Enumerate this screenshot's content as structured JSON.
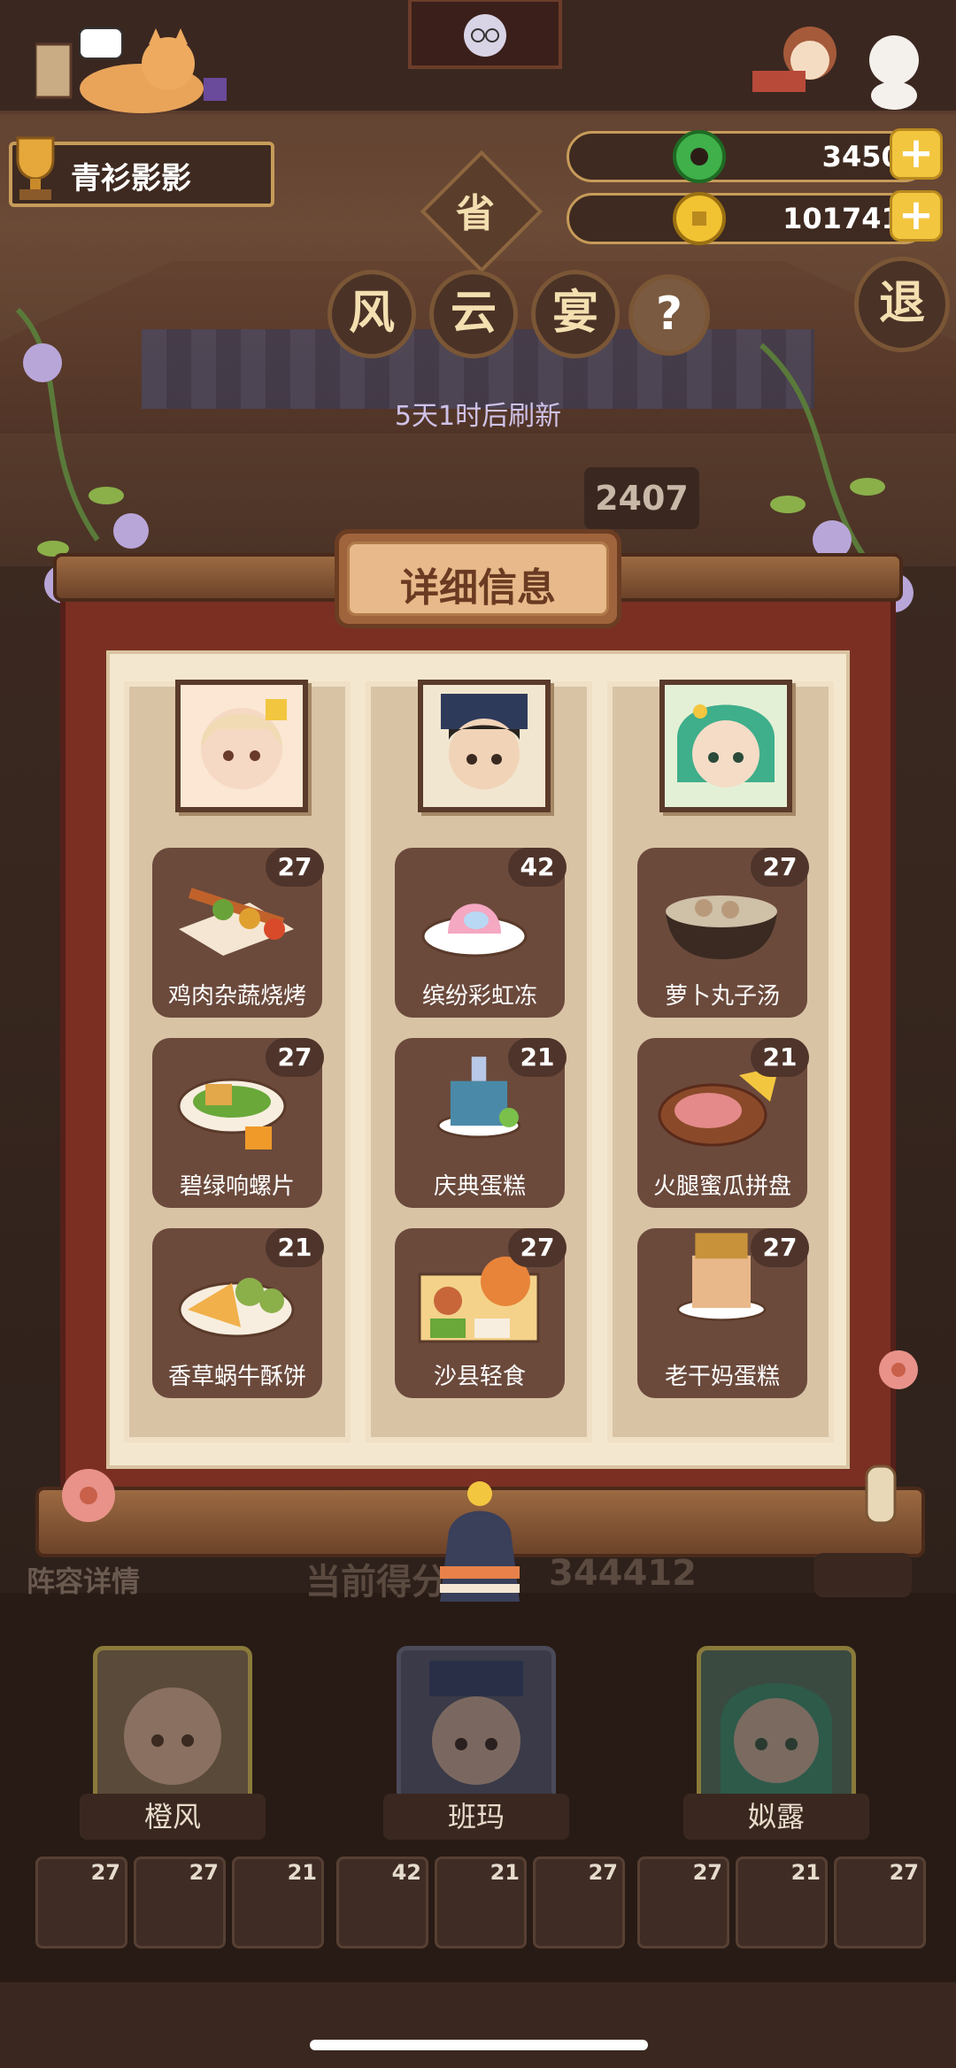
{
  "player": {
    "name": "青衫影影"
  },
  "currency": {
    "jade": "34507",
    "coins": "1017413"
  },
  "header": {
    "province_char": "省",
    "title_chars": [
      "风",
      "云",
      "宴"
    ],
    "help": "?",
    "exit": "退",
    "refresh": "5天1时后刷新",
    "score_peek": "2407"
  },
  "modal": {
    "title": "详细信息",
    "columns": [
      {
        "dishes": [
          {
            "name": "鸡肉杂蔬烧烤",
            "count": "27"
          },
          {
            "name": "碧绿响螺片",
            "count": "27"
          },
          {
            "name": "香草蜗牛酥饼",
            "count": "21"
          }
        ]
      },
      {
        "dishes": [
          {
            "name": "缤纷彩虹冻",
            "count": "42"
          },
          {
            "name": "庆典蛋糕",
            "count": "21"
          },
          {
            "name": "沙县轻食",
            "count": "27"
          }
        ]
      },
      {
        "dishes": [
          {
            "name": "萝卜丸子汤",
            "count": "27"
          },
          {
            "name": "火腿蜜瓜拼盘",
            "count": "21"
          },
          {
            "name": "老干妈蛋糕",
            "count": "27"
          }
        ]
      }
    ]
  },
  "lineup": {
    "label": "阵容详情",
    "score_label": "当前得分",
    "score_value": "344412",
    "characters": [
      {
        "name": "橙风"
      },
      {
        "name": "班玛"
      },
      {
        "name": "姒露"
      }
    ],
    "mini_counts": [
      "27",
      "27",
      "21",
      "42",
      "21",
      "27",
      "27",
      "21",
      "27"
    ]
  }
}
